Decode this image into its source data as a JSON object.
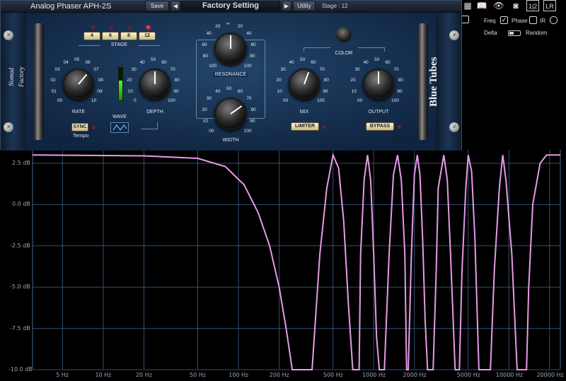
{
  "plugin": {
    "title": "Analog Phaser APH-2S",
    "save_label": "Save",
    "preset": "Factory Setting",
    "utility_label": "Utility",
    "status": "Stage : 12",
    "brand": "Blue Tubes",
    "logo": "Nomad Factory",
    "stage": {
      "label": "STAGE",
      "options": [
        "4",
        "6",
        "8",
        "12"
      ],
      "selected": "12"
    },
    "rate": {
      "label": "RATE",
      "ticks": [
        "00",
        "01",
        "02",
        "03",
        "04",
        "05",
        "06",
        "07",
        "08",
        "09",
        "10"
      ]
    },
    "depth": {
      "label": "DEPTH",
      "ticks": [
        "0",
        "10",
        "20",
        "30",
        "40",
        "50",
        "60",
        "70",
        "80",
        "90",
        "100"
      ]
    },
    "resonance": {
      "label": "RESONANCE",
      "ticks": [
        "100",
        "80",
        "60",
        "40",
        "20",
        "∞",
        "20",
        "40",
        "60",
        "80",
        "100"
      ]
    },
    "width": {
      "label": "WIDTH",
      "ticks": [
        "00",
        "10",
        "20",
        "30",
        "40",
        "50",
        "60",
        "70",
        "80",
        "90",
        "100"
      ]
    },
    "mix": {
      "label": "MIX",
      "ticks": [
        "00",
        "10",
        "20",
        "30",
        "40",
        "50",
        "60",
        "70",
        "80",
        "90",
        "100"
      ]
    },
    "output": {
      "label": "OUTPUT",
      "ticks": [
        "00",
        "10",
        "20",
        "30",
        "40",
        "50",
        "60",
        "70",
        "80",
        "90",
        "100"
      ]
    },
    "color_label": "COLOR",
    "wave_label": "WAVE",
    "sync_label": "SYNC",
    "tempo_label": "Tempo",
    "limiter_label": "LIMITER",
    "bypass_label": "BYPASS"
  },
  "toolbar": {
    "icons": [
      "book-icon",
      "eye-icon",
      "camera-icon",
      "half-icon",
      "lr-icon"
    ],
    "half_label": "1|2",
    "lr_label": "LR",
    "freq_label": "Freq",
    "freq_checked": true,
    "phase_label": "Phase",
    "phase_checked": false,
    "ir_label": "IR",
    "delta_label": "Delta",
    "random_label": "Random"
  },
  "analyzer": {
    "y_labels": [
      "2.5 dB",
      "0.0 dB",
      "-2.5 dB",
      "-5.0 dB",
      "-7.5 dB",
      "-10.0 dB"
    ],
    "x_labels": [
      "5 Hz",
      "10 Hz",
      "20 Hz",
      "50 Hz",
      "100 Hz",
      "200 Hz",
      "500 Hz",
      "1000 Hz",
      "2000 Hz",
      "5000 Hz",
      "10000 Hz",
      "20000 Hz"
    ],
    "curve_color": "#e79ae6",
    "grid_color": "#33506e"
  },
  "chart_data": {
    "type": "line",
    "xscale": "log",
    "xlim": [
      3,
      24000
    ],
    "ylim": [
      -10,
      3.5
    ],
    "series": [
      {
        "x": [
          3,
          20,
          50,
          80,
          110,
          140,
          170,
          200,
          225,
          250,
          300,
          350,
          400,
          450,
          500,
          550,
          600,
          650,
          700,
          780,
          800,
          850,
          900,
          950,
          1000,
          1050,
          1100,
          1200,
          1300,
          1400,
          1500,
          1600,
          1700,
          1750,
          1800,
          1900,
          2000,
          2100,
          2200,
          2300,
          2400,
          2500,
          2600,
          2750,
          2900,
          3000,
          3300,
          3500,
          3700,
          4000,
          4300,
          4500,
          4800,
          5000,
          5300,
          5600,
          6000,
          6700,
          7300,
          7800,
          8500,
          9000,
          9500,
          10500,
          11500,
          12500,
          13500,
          14000,
          15000,
          17000,
          19000,
          21000,
          24000
        ],
        "y": [
          3.0,
          2.95,
          2.8,
          2.3,
          1.2,
          -0.5,
          -2.5,
          -5,
          -7.5,
          -10,
          -10,
          -10,
          -3,
          1,
          3.0,
          2.2,
          -1,
          -6,
          -10,
          -10,
          -3,
          1.5,
          3.0,
          1.5,
          -3,
          -8,
          -10,
          -10,
          -3,
          1.8,
          3.0,
          1.5,
          -3,
          -10,
          -10,
          -3,
          1.8,
          3.0,
          1.8,
          -2,
          -7,
          -10,
          -10,
          -10,
          -4,
          1,
          3.0,
          1.5,
          -3,
          -10,
          -10,
          -4,
          1,
          3.0,
          2.0,
          -2,
          -10,
          -10,
          -10,
          -4,
          1,
          3.0,
          1.5,
          -3,
          -10,
          -10,
          -10,
          -5,
          0,
          2.5,
          3.0,
          3.0,
          3.0
        ]
      }
    ]
  }
}
